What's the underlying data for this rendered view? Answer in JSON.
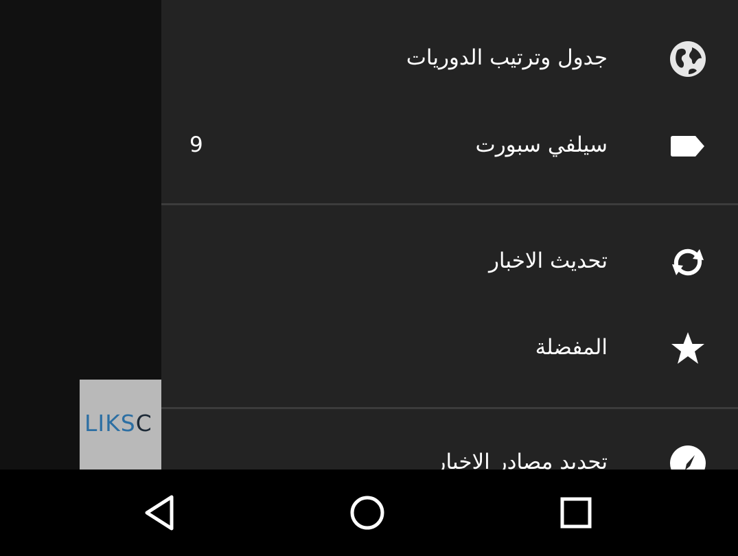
{
  "background_ad": {
    "text_part1": "LIKS",
    "text_part2": "C",
    "bg_color": "#b9b9b9"
  },
  "drawer": {
    "bg_color": "#232323",
    "items": [
      {
        "label": "جدول وترتيب الدوريات",
        "icon": "globe-icon"
      },
      {
        "label": "سيلفي سبورت",
        "icon": "label-tag-icon",
        "count": "9"
      },
      {
        "label": "تحديث الاخبار",
        "icon": "refresh-icon"
      },
      {
        "label": "المفضلة",
        "icon": "star-icon"
      },
      {
        "label": "تحديد مصادر الاخبار",
        "icon": "compass-icon"
      }
    ]
  },
  "nav_bar": {
    "buttons": [
      "back-icon",
      "home-icon",
      "recents-icon"
    ]
  }
}
